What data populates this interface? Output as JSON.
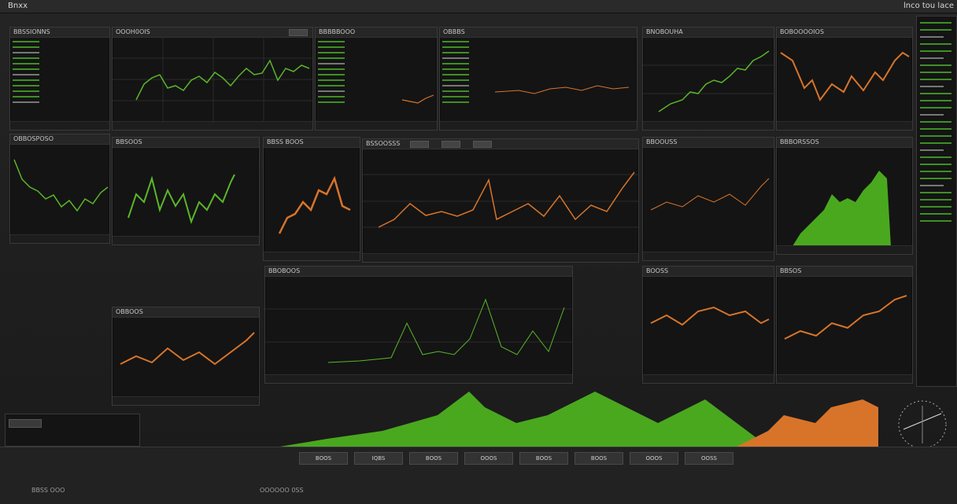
{
  "app": {
    "title": "Bnxx",
    "right_title": "lnco tou lace"
  },
  "panels": {
    "p1": {
      "title": "BBSSIONNS"
    },
    "p2": {
      "title": "OOOH0OIS"
    },
    "p3": {
      "title": "BBBBBOOO"
    },
    "p4": {
      "title": "OBBBS"
    },
    "p5": {
      "title": "BNOBOUHA"
    },
    "p6": {
      "title": "BOBOOOOIOS"
    },
    "p7": {
      "title": "OBBOSPOSO"
    },
    "p8": {
      "title": "BBSOOS"
    },
    "p9": {
      "title": "BBSS BOOS"
    },
    "p10": {
      "title": "BSSOOSSS"
    },
    "p11": {
      "title": "BBOOUSS"
    },
    "p12": {
      "title": "BBBORSSOS"
    },
    "p13": {
      "title": "BBOBOOS"
    },
    "p14": {
      "title": "BOOSS"
    },
    "p15": {
      "title": "BBSOS"
    },
    "p16": {
      "title": "OBBOOS"
    }
  },
  "bottom": {
    "tabs": [
      "BOOS",
      "IQBS",
      "BOOS",
      "OOOS",
      "BOOS",
      "BOOS",
      "OOOS",
      "OOSS"
    ],
    "labels": [
      "BBSS OOO",
      "OOOOOO 0SS"
    ]
  },
  "colors": {
    "green": "#5ab62a",
    "orange": "#d8742a",
    "grid": "#2a2a2a"
  }
}
